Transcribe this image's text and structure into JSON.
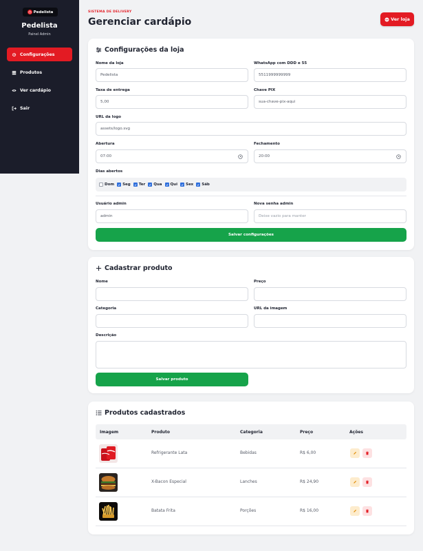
{
  "sidebar": {
    "brand": "Pedelista",
    "title": "Pedelista",
    "subtitle": "Painel Admin",
    "items": [
      {
        "label": "Configurações",
        "icon": "gear-icon",
        "active": true
      },
      {
        "label": "Produtos",
        "icon": "stack-icon",
        "active": false
      },
      {
        "label": "Ver cardápio",
        "icon": "eye-icon",
        "active": false
      },
      {
        "label": "Sair",
        "icon": "logout-icon",
        "active": false
      }
    ]
  },
  "header": {
    "eyebrow": "SISTEMA DE DELIVERY",
    "title": "Gerenciar cardápio",
    "view_store_label": "Ver loja"
  },
  "settings": {
    "title": "Configurações da loja",
    "store_name_label": "Nome da loja",
    "store_name_value": "Pedelista",
    "whatsapp_label": "WhatsApp com DDD e 55",
    "whatsapp_value": "5511999999999",
    "delivery_fee_label": "Taxa de entrega",
    "delivery_fee_value": "5,00",
    "pix_label": "Chave PIX",
    "pix_placeholder": "sua-chave-pix-aqui",
    "logo_url_label": "URL da logo",
    "logo_url_value": "assets/logo.svg",
    "open_label": "Abertura",
    "open_value": "07:00",
    "close_label": "Fechamento",
    "close_value": "20:00",
    "days_label": "Dias abertos",
    "days": [
      {
        "label": "Dom",
        "checked": false
      },
      {
        "label": "Seg",
        "checked": true
      },
      {
        "label": "Ter",
        "checked": true
      },
      {
        "label": "Qua",
        "checked": true
      },
      {
        "label": "Qui",
        "checked": true
      },
      {
        "label": "Sex",
        "checked": true
      },
      {
        "label": "Sáb",
        "checked": true
      }
    ],
    "admin_user_label": "Usuário admin",
    "admin_user_value": "admin",
    "admin_pass_label": "Nova senha admin",
    "admin_pass_placeholder": "Deixe vazio para manter",
    "save_label": "Salvar configurações"
  },
  "new_product": {
    "title": "Cadastrar produto",
    "name_label": "Nome",
    "price_label": "Preço",
    "category_label": "Categoria",
    "image_url_label": "URL da imagem",
    "description_label": "Descrição",
    "save_label": "Salvar produto"
  },
  "products": {
    "title": "Produtos cadastrados",
    "columns": [
      "Imagem",
      "Produto",
      "Categoria",
      "Preço",
      "Ações"
    ],
    "rows": [
      {
        "name": "Refrigerante Lata",
        "category": "Bebidas",
        "price": "R$ 6,00",
        "image": "soda-can"
      },
      {
        "name": "X-Bacon Especial",
        "category": "Lanches",
        "price": "R$ 24,90",
        "image": "burger"
      },
      {
        "name": "Batata Frita",
        "category": "Porções",
        "price": "R$ 16,00",
        "image": "fries"
      }
    ]
  },
  "colors": {
    "accent": "#e31b23",
    "sidebar_bg": "#1b1d2a",
    "success": "#16a34a",
    "checkbox": "#2f6fdc"
  }
}
